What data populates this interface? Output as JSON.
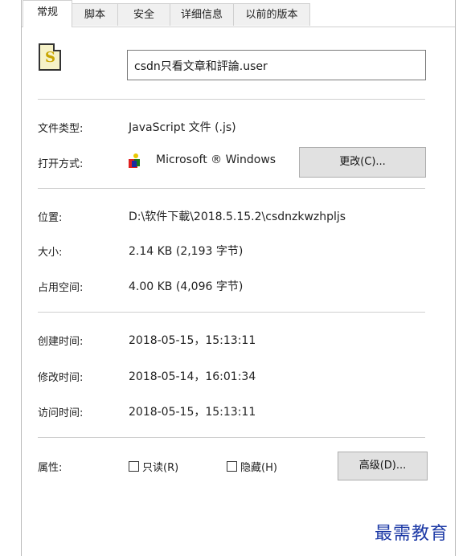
{
  "tabs": [
    {
      "label": "常规",
      "active": true
    },
    {
      "label": "脚本"
    },
    {
      "label": "安全"
    },
    {
      "label": "详细信息"
    },
    {
      "label": "以前的版本"
    }
  ],
  "file": {
    "icon": "script-file-icon",
    "name": "csdn只看文章和評論.user"
  },
  "props": {
    "type_label": "文件类型:",
    "type_value": "JavaScript 文件 (.js)",
    "open_label": "打开方式:",
    "open_value": "Microsoft ® Windows",
    "change_button": "更改(C)...",
    "location_label": "位置:",
    "location_value": "D:\\软件下載\\2018.5.15.2\\csdnzkwzhpljs",
    "size_label": "大小:",
    "size_value": "2.14 KB (2,193 字节)",
    "disk_label": "占用空间:",
    "disk_value": "4.00 KB (4,096 字节)",
    "created_label": "创建时间:",
    "created_value": "2018-05-15，15:13:11",
    "modified_label": "修改时间:",
    "modified_value": "2018-05-14，16:01:34",
    "accessed_label": "访问时间:",
    "accessed_value": "2018-05-15，15:13:11"
  },
  "attributes": {
    "label": "属性:",
    "readonly_label": "只读(R)",
    "readonly_checked": false,
    "hidden_label": "隐藏(H)",
    "hidden_checked": false,
    "advanced_button": "高级(D)..."
  },
  "watermark": "最需教育"
}
